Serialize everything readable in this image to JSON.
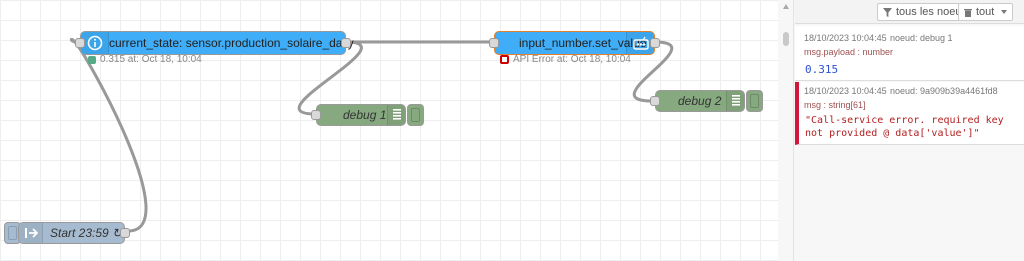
{
  "flow": {
    "nodes": {
      "current_state": {
        "label": "current_state: sensor.production_solaire_daily",
        "status": "0.315 at: Oct 18, 10:04",
        "icon": "info-circle-icon"
      },
      "input_number": {
        "label": "input_number.set_value",
        "status": "API Error at: Oct 18, 10:04",
        "icon": "home-assistant-icon"
      },
      "debug1": {
        "label": "debug 1",
        "icon": "list-lines-icon"
      },
      "debug2": {
        "label": "debug 2",
        "icon": "list-lines-icon"
      },
      "inject": {
        "label": "Start 23:59 ↻",
        "icon": "arrow-right-icon"
      }
    },
    "colors": {
      "ha_node": "#3fadf7",
      "debug_node": "#87a980",
      "inject_node": "#a6bbcf",
      "error": "#d0163b",
      "ok": "#5a8"
    }
  },
  "sidebar": {
    "filter_nodes": "tous les noeuds",
    "clear_all": "tout",
    "messages": [
      {
        "timestamp": "18/10/2023 10:04:45",
        "node": "noeud: debug 1",
        "type": "msg.payload : number",
        "value": "0.315"
      },
      {
        "timestamp": "18/10/2023 10:04:45",
        "node": "noeud: 9a909b39a4461fd8",
        "type": "msg : string[61]",
        "value": "\"Call-service error. required key\nnot provided @ data['value']\""
      }
    ]
  }
}
